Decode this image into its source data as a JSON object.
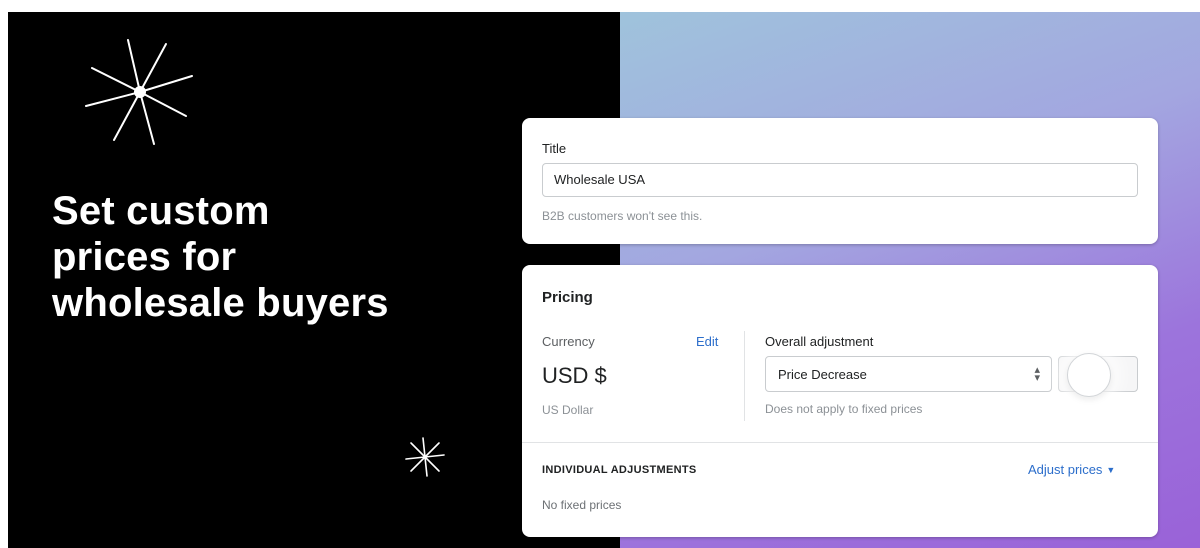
{
  "hero": {
    "headline": "Set custom prices for wholesale buyers"
  },
  "title_card": {
    "label": "Title",
    "value": "Wholesale USA",
    "help_text": "B2B customers won't see this."
  },
  "pricing_card": {
    "heading": "Pricing",
    "currency": {
      "label": "Currency",
      "edit_link": "Edit",
      "value": "USD $",
      "name": "US Dollar"
    },
    "overall_adjustment": {
      "label": "Overall adjustment",
      "selected": "Price Decrease",
      "help_text": "Does not apply to fixed prices"
    },
    "individual_adjustments": {
      "label": "INDIVIDUAL ADJUSTMENTS",
      "action": "Adjust prices",
      "empty_text": "No fixed prices"
    }
  },
  "icons": {
    "sparkle_large": "sparkle-icon",
    "sparkle_small": "sparkle-icon",
    "select_caret": "up-down-caret-icon",
    "dropdown": "caret-down-icon"
  },
  "colors": {
    "link": "#2c6ecb",
    "background_dark": "#000000",
    "gradient_start": "#9fc3dc",
    "gradient_end": "#9a62d8"
  }
}
